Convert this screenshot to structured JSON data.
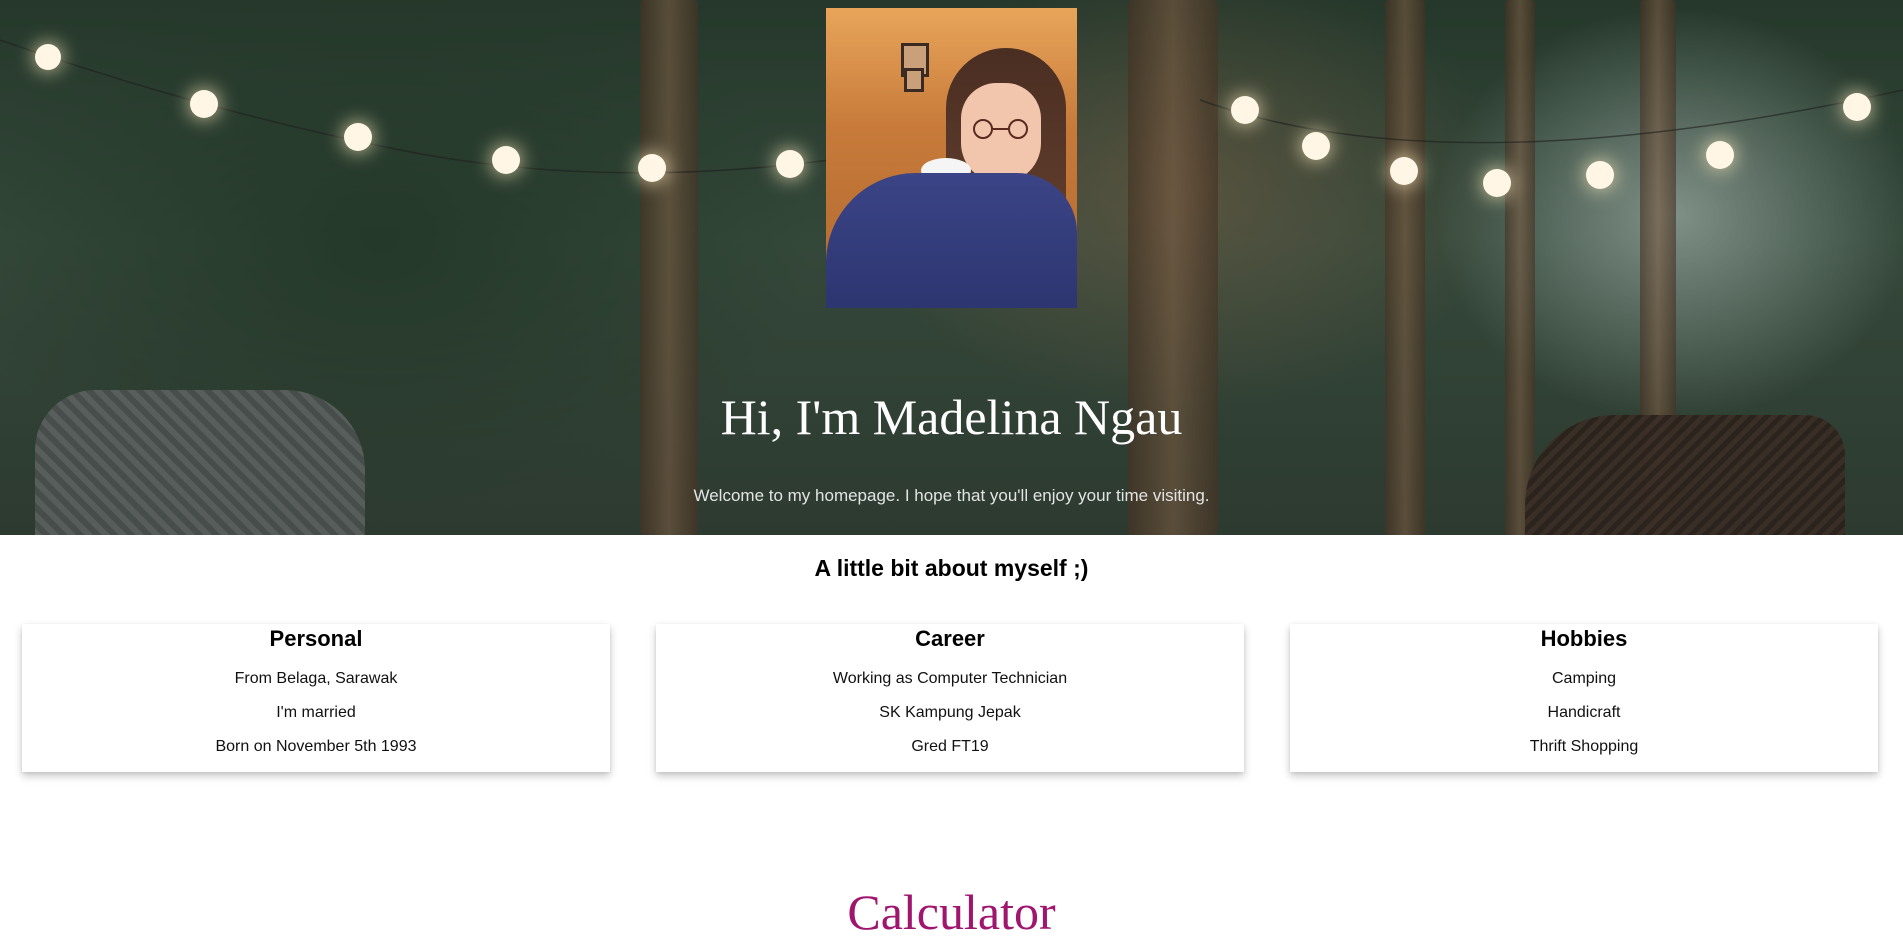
{
  "hero": {
    "photo_name": "profile-photo",
    "title": "Hi, I'm Madelina Ngau",
    "subtitle": "Welcome to my homepage. I hope that you'll enjoy your time visiting."
  },
  "about": {
    "heading": "A little bit about myself ;)",
    "cards": [
      {
        "title": "Personal",
        "items": [
          "From Belaga, Sarawak",
          "I'm married",
          "Born on November 5th 1993"
        ]
      },
      {
        "title": "Career",
        "items": [
          "Working as Computer Technician",
          "SK Kampung Jepak",
          "Gred FT19"
        ]
      },
      {
        "title": "Hobbies",
        "items": [
          "Camping",
          "Handicraft",
          "Thrift Shopping"
        ]
      }
    ]
  },
  "calculator": {
    "title": "Calculator",
    "color": "#a0156e"
  }
}
